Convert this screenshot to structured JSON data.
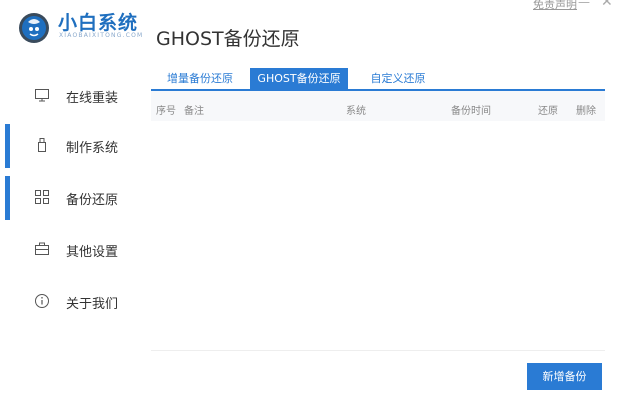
{
  "app": {
    "name": "小白系统",
    "subtitle": "XIAOBAIXITONG.COM"
  },
  "window": {
    "disclaimer": "免责声明",
    "minimize": "—",
    "close": "✕"
  },
  "page_title": "GHOST备份还原",
  "sidebar": {
    "items": [
      {
        "label": "在线重装",
        "icon": "monitor-icon",
        "active": false
      },
      {
        "label": "制作系统",
        "icon": "usb-icon",
        "active": true
      },
      {
        "label": "备份还原",
        "icon": "grid-icon",
        "active": true
      },
      {
        "label": "其他设置",
        "icon": "briefcase-icon",
        "active": false
      },
      {
        "label": "关于我们",
        "icon": "info-icon",
        "active": false
      }
    ]
  },
  "tabs": [
    {
      "label": "增量备份还原",
      "active": false
    },
    {
      "label": "GHOST备份还原",
      "active": true
    },
    {
      "label": "自定义还原",
      "active": false
    }
  ],
  "table": {
    "columns": [
      "序号",
      "备注",
      "系统",
      "备份时间",
      "还原",
      "删除"
    ],
    "rows": []
  },
  "actions": {
    "add_backup": "新增备份"
  },
  "colors": {
    "accent": "#2a7bd4",
    "brand": "#1f6fbf"
  }
}
